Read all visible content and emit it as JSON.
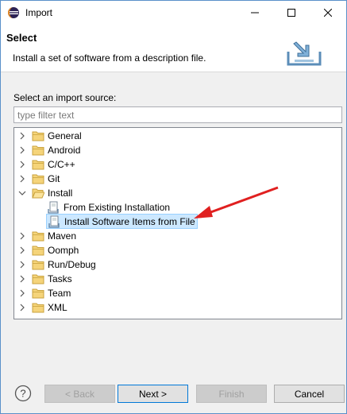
{
  "window": {
    "title": "Import"
  },
  "banner": {
    "title": "Select",
    "description": "Install a set of software from a description file."
  },
  "main": {
    "source_label": "Select an import source:",
    "filter_placeholder": "type filter text"
  },
  "tree": {
    "items": [
      {
        "label": "General",
        "type": "folder",
        "expanded": false
      },
      {
        "label": "Android",
        "type": "folder",
        "expanded": false
      },
      {
        "label": "C/C++",
        "type": "folder",
        "expanded": false
      },
      {
        "label": "Git",
        "type": "folder",
        "expanded": false
      },
      {
        "label": "Install",
        "type": "folder",
        "expanded": true
      },
      {
        "label": "From Existing Installation",
        "type": "leaf"
      },
      {
        "label": "Install Software Items from File",
        "type": "leaf",
        "selected": true
      },
      {
        "label": "Maven",
        "type": "folder",
        "expanded": false
      },
      {
        "label": "Oomph",
        "type": "folder",
        "expanded": false
      },
      {
        "label": "Run/Debug",
        "type": "folder",
        "expanded": false
      },
      {
        "label": "Tasks",
        "type": "folder",
        "expanded": false
      },
      {
        "label": "Team",
        "type": "folder",
        "expanded": false
      },
      {
        "label": "XML",
        "type": "folder",
        "expanded": false
      }
    ]
  },
  "buttons": {
    "back": "< Back",
    "next": "Next >",
    "finish": "Finish",
    "cancel": "Cancel"
  },
  "colors": {
    "selection_bg": "#cce8ff",
    "annotation_arrow": "#e02020",
    "folder": "#e8c56a"
  }
}
